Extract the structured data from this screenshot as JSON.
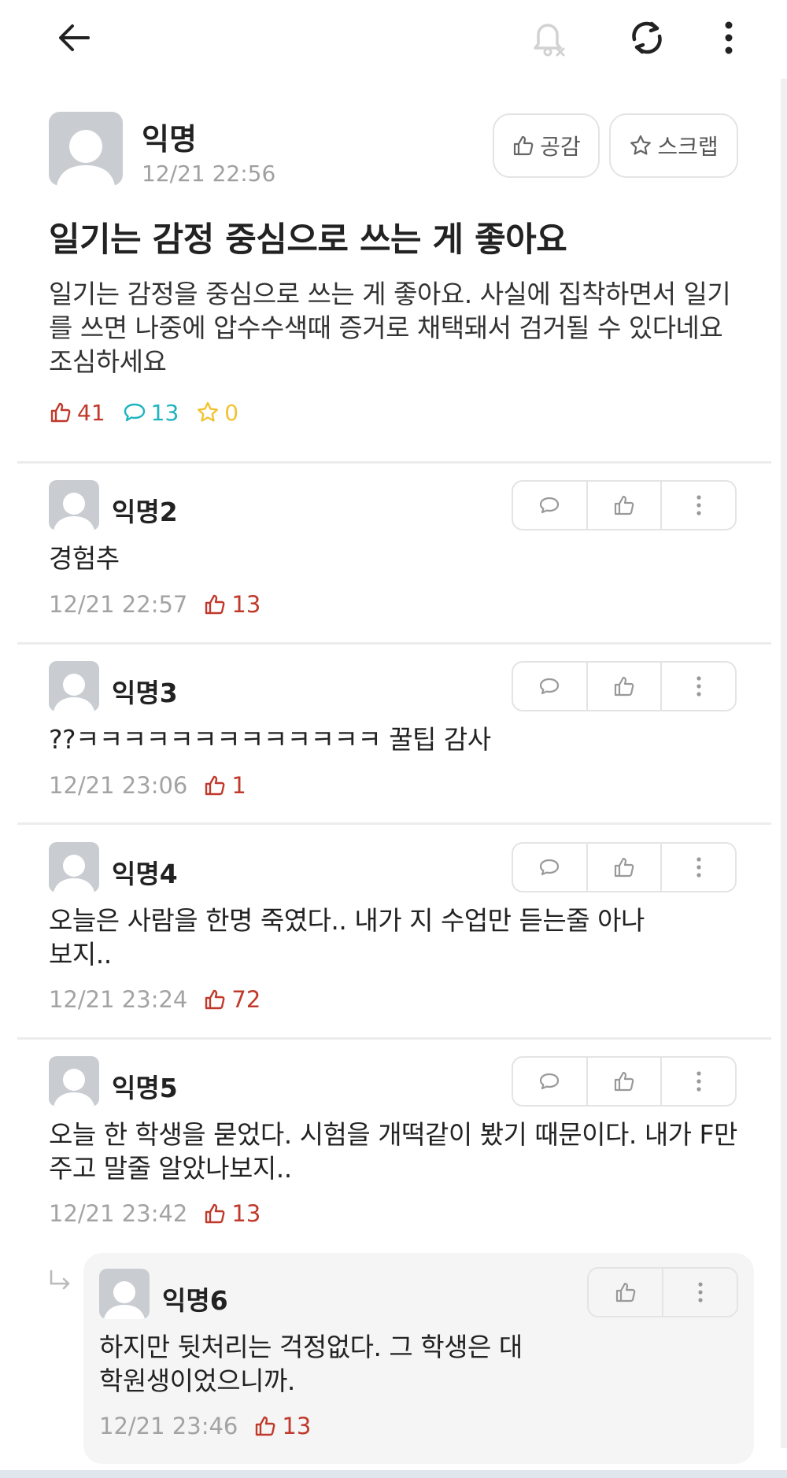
{
  "post": {
    "author": "익명",
    "time": "12/21 22:56",
    "empathy_label": "공감",
    "scrap_label": "스크랩",
    "title": "일기는 감정 중심으로 쓰는 게 좋아요",
    "body": "일기는 감정을 중심으로 쓰는 게 좋아요. 사실에 집착하면서 일기를 쓰면 나중에 압수수색때 증거로 채택돼서 검거될 수 있다네요 조심하세요",
    "stats": {
      "likes": "41",
      "comments": "13",
      "scraps": "0"
    }
  },
  "comments": [
    {
      "author": "익명2",
      "text": "경험추",
      "time": "12/21 22:57",
      "likes": "13"
    },
    {
      "author": "익명3",
      "text": "??ㅋㅋㅋㅋㅋㅋㅋㅋㅋㅋㅋㅋㅋ 꿀팁 감사",
      "time": "12/21 23:06",
      "likes": "1"
    },
    {
      "author": "익명4",
      "text": "오늘은 사람을 한명 죽였다.. 내가 지 수업만 듣는줄 아나보지..",
      "time": "12/21 23:24",
      "likes": "72"
    },
    {
      "author": "익명5",
      "text": "오늘 한 학생을 묻었다. 시험을 개떡같이 봤기 때문이다. 내가 F만 주고 말줄 알았나보지..",
      "time": "12/21 23:42",
      "likes": "13"
    }
  ],
  "reply": {
    "author": "익명6",
    "text": "하지만 뒷처리는 걱정없다. 그 학생은 대학원생이었으니까.",
    "time": "12/21 23:46",
    "likes": "13"
  },
  "icons": {
    "back": "back-arrow-icon",
    "notify": "notification-off-icon",
    "refresh": "refresh-icon",
    "more": "more-vertical-icon"
  },
  "colors": {
    "like": "#c0392b",
    "comment": "#1fb4bf",
    "scrap": "#f2c230",
    "meta": "#a3a3a3"
  }
}
